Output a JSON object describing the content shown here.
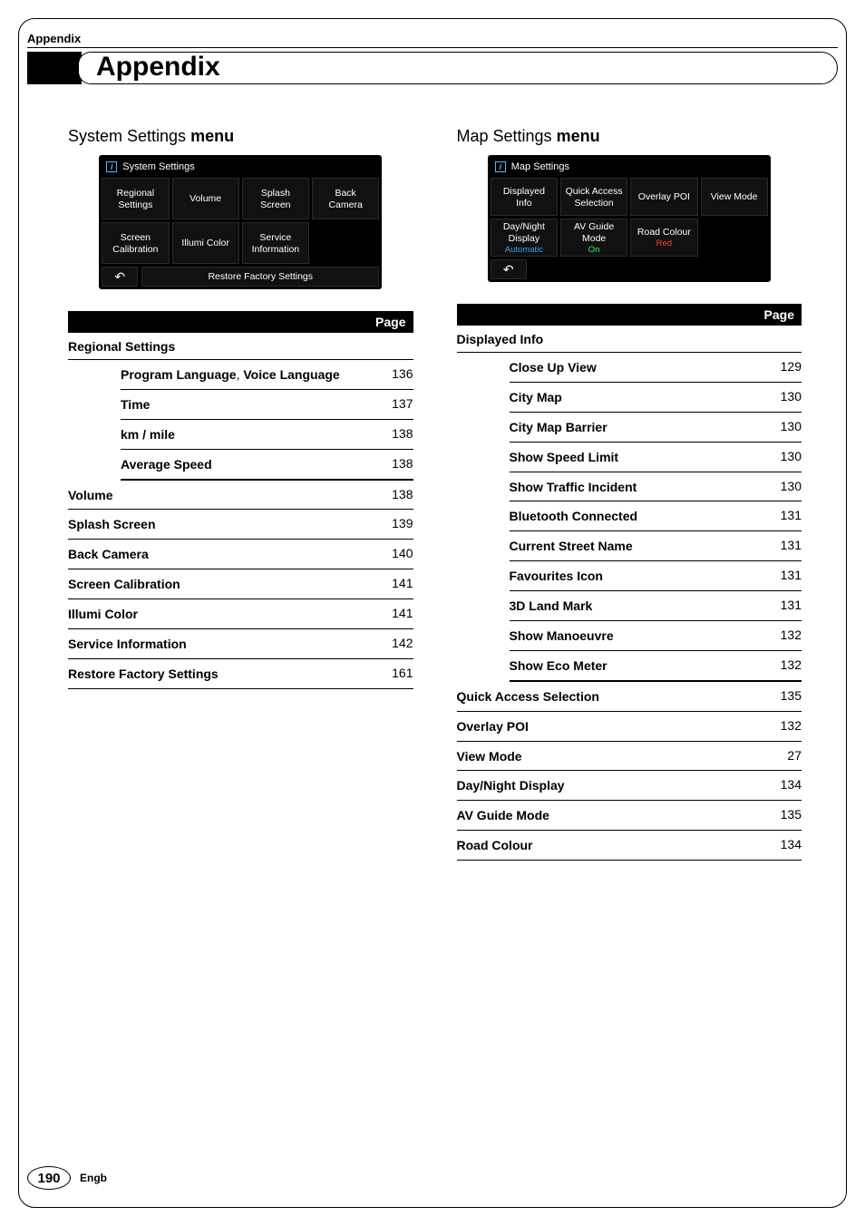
{
  "header": {
    "section_label": "Appendix",
    "title": "Appendix"
  },
  "footer": {
    "page_number": "190",
    "lang": "Engb"
  },
  "table_header": "Page",
  "left": {
    "heading_plain": "System Settings ",
    "heading_bold": "menu",
    "shot": {
      "title": "System Settings",
      "buttons": [
        {
          "line1": "Regional",
          "line2": "Settings"
        },
        {
          "line1": "Volume"
        },
        {
          "line1": "Splash",
          "line2": "Screen"
        },
        {
          "line1": "Back",
          "line2": "Camera"
        },
        {
          "line1": "Screen",
          "line2": "Calibration"
        },
        {
          "line1": "Illumi Color"
        },
        {
          "line1": "Service",
          "line2": "Information"
        },
        {
          "empty": true
        }
      ],
      "footer_btn": "Restore Factory Settings"
    },
    "groups": [
      {
        "head": "Regional Settings",
        "items": [
          {
            "label_html": "Program Language, Voice Language",
            "label_parts": [
              "Program Language",
              ", ",
              "Voice Language"
            ],
            "page": "136"
          },
          {
            "label": "Time",
            "page": "137"
          },
          {
            "label": "km / mile",
            "page": "138"
          },
          {
            "label": "Average Speed",
            "page": "138"
          }
        ]
      }
    ],
    "rows": [
      {
        "label": "Volume",
        "page": "138"
      },
      {
        "label": "Splash Screen",
        "page": "139"
      },
      {
        "label": "Back Camera",
        "page": "140"
      },
      {
        "label": "Screen Calibration",
        "page": "141"
      },
      {
        "label": "Illumi Color",
        "page": "141"
      },
      {
        "label": "Service Information",
        "page": "142"
      },
      {
        "label": "Restore Factory Settings",
        "page": "161"
      }
    ]
  },
  "right": {
    "heading_plain": "Map Settings ",
    "heading_bold": "menu",
    "shot": {
      "title": "Map Settings",
      "buttons": [
        {
          "line1": "Displayed",
          "line2": "Info"
        },
        {
          "line1": "Quick Access",
          "line2": "Selection"
        },
        {
          "line1": "Overlay POI"
        },
        {
          "line1": "View Mode"
        },
        {
          "line1": "Day/Night",
          "line2": "Display",
          "sub": "Automatic",
          "subclass": "sub-auto"
        },
        {
          "line1": "AV Guide",
          "line2": "Mode",
          "sub": "On",
          "subclass": "sub-on"
        },
        {
          "line1": "Road Colour",
          "sub": "Red",
          "subclass": "sub-red"
        },
        {
          "empty": true
        }
      ]
    },
    "groups": [
      {
        "head": "Displayed Info",
        "items": [
          {
            "label": "Close Up View",
            "page": "129"
          },
          {
            "label": "City Map",
            "page": "130"
          },
          {
            "label": "City Map Barrier",
            "page": "130"
          },
          {
            "label": "Show Speed Limit",
            "page": "130"
          },
          {
            "label": "Show Traffic Incident",
            "page": "130"
          },
          {
            "label": "Bluetooth Connected",
            "page": "131"
          },
          {
            "label": "Current Street Name",
            "page": "131"
          },
          {
            "label": "Favourites Icon",
            "page": "131"
          },
          {
            "label": "3D Land Mark",
            "page": "131"
          },
          {
            "label": "Show Manoeuvre",
            "page": "132"
          },
          {
            "label": "Show Eco Meter",
            "page": "132"
          }
        ]
      }
    ],
    "rows": [
      {
        "label": "Quick Access Selection",
        "page": "135"
      },
      {
        "label": "Overlay POI",
        "page": "132"
      },
      {
        "label": "View Mode",
        "page": "27"
      },
      {
        "label": "Day/Night Display",
        "page": "134"
      },
      {
        "label": "AV Guide Mode",
        "page": "135"
      },
      {
        "label": "Road Colour",
        "page": "134"
      }
    ]
  }
}
